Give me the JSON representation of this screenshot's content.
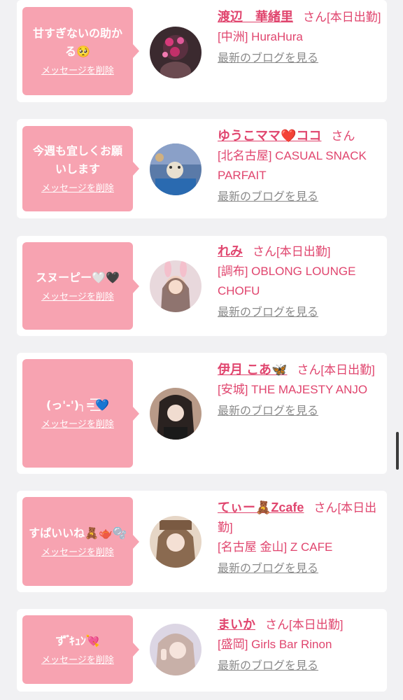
{
  "entries": [
    {
      "message": "甘すぎないの助かる🥺",
      "delete_label": "メッセージを削除",
      "name": "渡辺　華緒里",
      "honorific": "さん",
      "status": "[本日出勤]",
      "shop": "[中洲] HuraHura",
      "blog_link": "最新のブログを見る"
    },
    {
      "message": "今週も宜しくお願いします",
      "delete_label": "メッセージを削除",
      "name": "ゆうこママ❤️ココ",
      "honorific": "さん",
      "status": "",
      "shop": "[北名古屋] CASUAL SNACK PARFAIT",
      "blog_link": "最新のブログを見る"
    },
    {
      "message": "スヌーピー🤍🖤",
      "delete_label": "メッセージを削除",
      "name": "れみ",
      "honorific": "さん",
      "status": "[本日出勤]",
      "shop": "[調布] OBLONG LOUNGE CHOFU",
      "blog_link": "最新のブログを見る"
    },
    {
      "message": "(っ'-')╮=͟͟͞͞💙",
      "delete_label": "メッセージを削除",
      "name": "伊月 こあ🦋",
      "honorific": "さん",
      "status": "[本日出勤]",
      "shop": "[安城] THE MAJESTY ANJO",
      "blog_link": "最新のブログを見る"
    },
    {
      "message": "すぱいいね🧸🫖🫧",
      "delete_label": "メッセージを削除",
      "name": "てぃー🧸Zcafe",
      "honorific": "さん",
      "status": "[本日出勤]",
      "shop": "[名古屋 金山] Z CAFE",
      "blog_link": "最新のブログを見る"
    },
    {
      "message": "ず ゙ｷｭﾝ💘",
      "delete_label": "メッセージを削除",
      "name": "まいか",
      "honorific": "さん",
      "status": "[本日出勤]",
      "shop": "[盛岡] Girls Bar Rinon",
      "blog_link": "最新のブログを見る"
    }
  ],
  "colors": {
    "accent": "#e0456e",
    "bubble": "#f7a3b1",
    "muted": "#8a8a8a",
    "background": "#f1f1f3"
  }
}
